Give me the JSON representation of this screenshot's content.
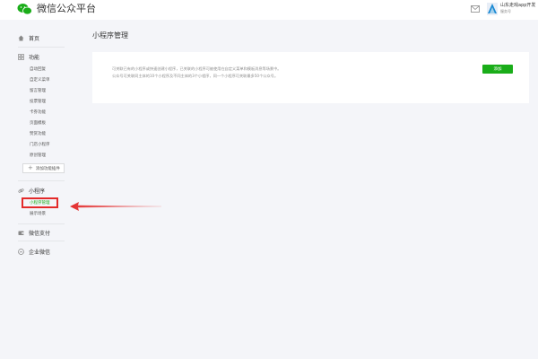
{
  "header": {
    "title": "微信公众平台",
    "account_name": "山东走戏app开发",
    "account_role": "服务号"
  },
  "sidebar": {
    "home": "首页",
    "function": {
      "label": "功能",
      "items": [
        "自动回复",
        "自定义菜单",
        "留言管理",
        "投票管理",
        "卡券功能",
        "页面模板",
        "赞赏功能",
        "门店小程序",
        "原创管理"
      ],
      "add_plugin": "添加功能插件"
    },
    "mini_program": {
      "label": "小程序",
      "items": [
        "小程序管理",
        "展示场景"
      ]
    },
    "wechat_pay": "微信支付",
    "work_wechat": "企业微信"
  },
  "main": {
    "title": "小程序管理",
    "description_line1": "可关联已有的小程序或快速创建小程序，已关联的小程序可被使用在自定义菜单和模板消息等场景中。",
    "description_line2": "公众号可关联同主体的10个小程序及不同主体的3个小程序，同一个小程序可关联最多50个公众号。",
    "add_button": "添加"
  },
  "colors": {
    "accent": "#1aad19",
    "annotation": "#e32a2a"
  }
}
